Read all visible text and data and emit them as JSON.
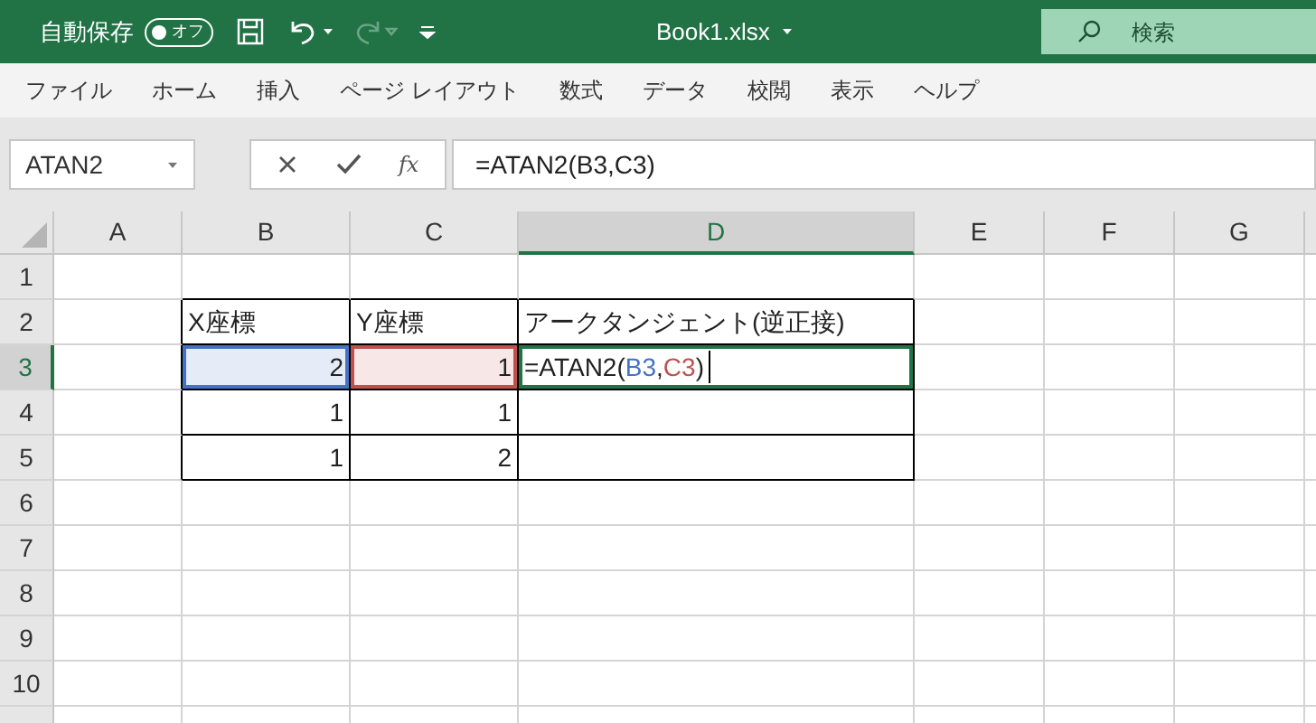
{
  "title_bar": {
    "autosave_label": "自動保存",
    "autosave_toggle": {
      "label": "オフ",
      "on": false
    },
    "redo_disabled": true,
    "file_name": "Book1.xlsx",
    "search": {
      "placeholder": "検索"
    }
  },
  "menu": [
    "ファイル",
    "ホーム",
    "挿入",
    "ページ レイアウト",
    "数式",
    "データ",
    "校閲",
    "表示",
    "ヘルプ"
  ],
  "formula_bar": {
    "name_box": "ATAN2",
    "function_button": "fx",
    "formula": "=ATAN2(B3,C3)"
  },
  "sheet": {
    "columns": [
      {
        "label": "A",
        "selected": false
      },
      {
        "label": "B",
        "selected": false
      },
      {
        "label": "C",
        "selected": false
      },
      {
        "label": "D",
        "selected": true
      },
      {
        "label": "E",
        "selected": false
      },
      {
        "label": "F",
        "selected": false
      },
      {
        "label": "G",
        "selected": false
      }
    ],
    "row_headers": [
      {
        "label": "1",
        "selected": false
      },
      {
        "label": "2",
        "selected": false
      },
      {
        "label": "3",
        "selected": true
      },
      {
        "label": "4",
        "selected": false
      },
      {
        "label": "5",
        "selected": false
      },
      {
        "label": "6",
        "selected": false
      },
      {
        "label": "7",
        "selected": false
      },
      {
        "label": "8",
        "selected": false
      },
      {
        "label": "9",
        "selected": false
      },
      {
        "label": "10",
        "selected": false
      }
    ],
    "table": {
      "rows": [
        [
          {
            "kind": "text",
            "text": "X座標"
          },
          {
            "kind": "text",
            "text": "Y座標"
          },
          {
            "kind": "text",
            "text": "アークタンジェント(逆正接)"
          }
        ],
        [
          {
            "kind": "number",
            "text": "2",
            "color": "#4472c4"
          },
          {
            "kind": "number",
            "text": "1",
            "color": "#c0504d"
          },
          {
            "kind": "formula",
            "selected": true,
            "parts": [
              {
                "text": "=ATAN2("
              },
              {
                "text": "B3",
                "color": "#4472c4"
              },
              {
                "text": ","
              },
              {
                "text": "C3",
                "color": "#c0504d"
              },
              {
                "text": ")"
              }
            ]
          }
        ],
        [
          {
            "kind": "number",
            "text": "1"
          },
          {
            "kind": "number",
            "text": "1"
          },
          {
            "kind": "text",
            "text": ""
          }
        ],
        [
          {
            "kind": "number",
            "text": "1"
          },
          {
            "kind": "number",
            "text": "2"
          },
          {
            "kind": "text",
            "text": ""
          }
        ]
      ]
    }
  }
}
